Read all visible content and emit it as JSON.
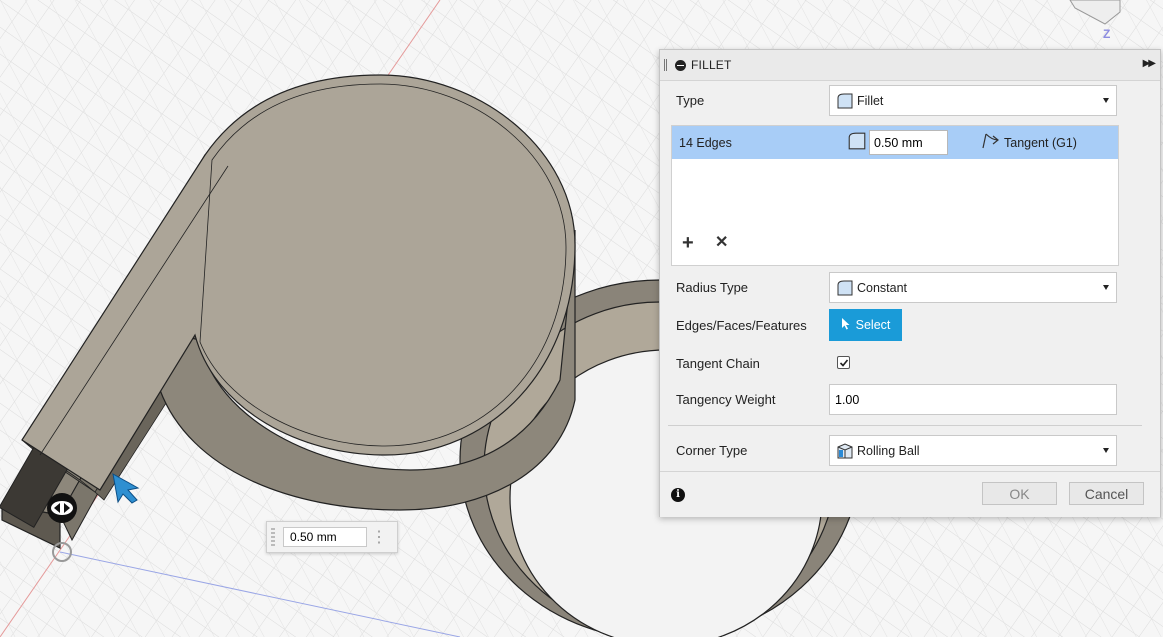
{
  "dialog": {
    "title": "FILLET",
    "type_label": "Type",
    "type_value": "Fillet",
    "edges": {
      "label": "14 Edges",
      "radius": "0.50 mm",
      "continuity": "Tangent (G1)"
    },
    "radius_type_label": "Radius Type",
    "radius_type_value": "Constant",
    "selection_label": "Edges/Faces/Features",
    "select_button": "Select",
    "tangent_chain_label": "Tangent Chain",
    "tangent_chain_checked": true,
    "tangency_weight_label": "Tangency Weight",
    "tangency_weight_value": "1.00",
    "corner_type_label": "Corner Type",
    "corner_type_value": "Rolling Ball",
    "ok_button": "OK",
    "cancel_button": "Cancel"
  },
  "viewport": {
    "dimension_value": "0.50 mm",
    "axis_label": "Z",
    "accent_color": "#1a9bd8",
    "selection_color": "#a8cdf7"
  }
}
